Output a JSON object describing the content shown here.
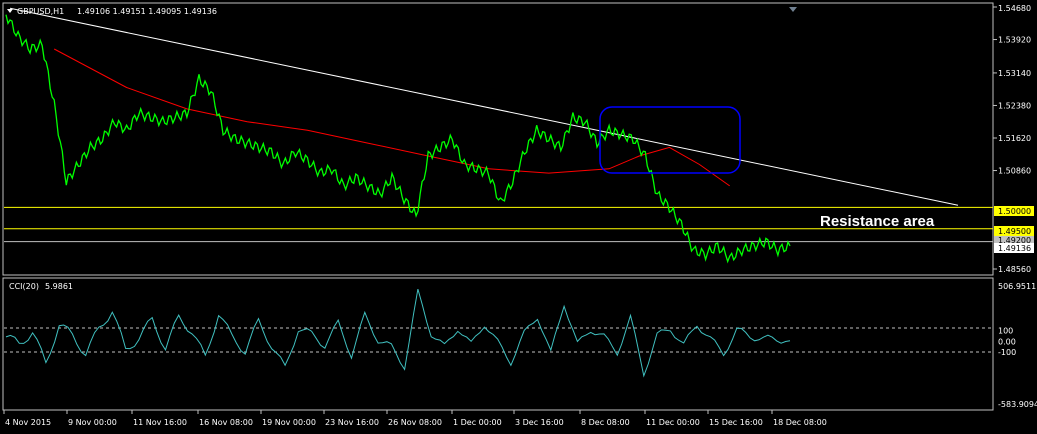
{
  "header": {
    "symbol": "GBPUSD,H1",
    "ohlc": "1.49106 1.49151 1.49095 1.49136"
  },
  "indicator_header": {
    "name": "CCI(20)",
    "value": "5.9861"
  },
  "annotation": "Resistance area",
  "price_axis": {
    "ticks": [
      "1.54680",
      "1.53920",
      "1.53140",
      "1.52380",
      "1.51620",
      "1.50860",
      "1.48560"
    ],
    "levels": [
      {
        "label": "1.50000",
        "value": 1.5
      },
      {
        "label": "1.49500",
        "value": 1.495
      },
      {
        "label": "1.49200",
        "value": 1.492
      }
    ],
    "current": {
      "label": "1.49136",
      "value": 1.49136
    }
  },
  "cci_axis": {
    "ticks": [
      "506.9511",
      "100",
      "0.00",
      "-100",
      "-583.9094"
    ]
  },
  "time_axis": [
    "4 Nov 2015",
    "9 Nov 00:00",
    "11 Nov 16:00",
    "16 Nov 08:00",
    "19 Nov 00:00",
    "23 Nov 16:00",
    "26 Nov 08:00",
    "1 Dec 00:00",
    "3 Dec 16:00",
    "8 Dec 08:00",
    "11 Dec 00:00",
    "15 Dec 16:00",
    "18 Dec 08:00"
  ],
  "colors": {
    "background": "#000000",
    "price": "#00ff00",
    "ma": "#ff0000",
    "trendline": "#ffffff",
    "level": "#ffff00",
    "highlight": "#0000ff",
    "cci": "#40c0c0"
  },
  "chart_data": {
    "type": "line",
    "title": "GBPUSD,H1",
    "ylim": [
      1.4856,
      1.5468
    ],
    "price_series": {
      "name": "GBPUSD",
      "x_index": [
        0,
        2,
        4,
        6,
        8,
        10,
        12,
        14,
        16,
        18,
        20,
        22,
        24,
        26,
        28,
        30,
        32,
        34,
        36,
        38,
        40,
        42,
        44,
        46,
        48,
        50,
        52,
        54,
        56,
        58,
        60,
        62,
        64,
        66,
        68,
        70,
        72,
        74,
        76,
        78,
        80,
        82,
        84,
        86,
        88,
        90,
        92,
        94,
        96,
        98,
        100,
        102,
        104,
        106,
        108,
        110,
        112,
        114,
        116,
        118,
        120,
        122,
        124,
        126,
        128,
        130
      ],
      "values": [
        1.545,
        1.54,
        1.537,
        1.538,
        1.524,
        1.506,
        1.51,
        1.514,
        1.516,
        1.52,
        1.518,
        1.522,
        1.521,
        1.52,
        1.521,
        1.522,
        1.53,
        1.527,
        1.518,
        1.516,
        1.515,
        1.514,
        1.513,
        1.51,
        1.513,
        1.511,
        1.508,
        1.509,
        1.505,
        1.507,
        1.505,
        1.503,
        1.507,
        1.502,
        1.498,
        1.512,
        1.514,
        1.516,
        1.51,
        1.509,
        1.508,
        1.501,
        1.506,
        1.513,
        1.518,
        1.516,
        1.514,
        1.521,
        1.52,
        1.515,
        1.518,
        1.517,
        1.516,
        1.512,
        1.503,
        1.5,
        1.496,
        1.49,
        1.489,
        1.491,
        1.488,
        1.49,
        1.491,
        1.492,
        1.49,
        1.491
      ]
    },
    "ma_series": {
      "name": "MA",
      "x_index": [
        8,
        20,
        30,
        40,
        50,
        60,
        70,
        80,
        90,
        100,
        105,
        110,
        115,
        120
      ],
      "values": [
        1.537,
        1.528,
        1.523,
        1.52,
        1.518,
        1.515,
        1.512,
        1.509,
        1.508,
        1.509,
        1.512,
        1.514,
        1.51,
        1.505
      ]
    },
    "trendline": {
      "from_value": 1.5465,
      "to_value": 1.5005
    },
    "cci_series": {
      "name": "CCI(20)",
      "values": [
        40,
        -20,
        80,
        -200,
        150,
        60,
        -120,
        120,
        280,
        -80,
        30,
        200,
        -60,
        220,
        90,
        -150,
        260,
        40,
        -90,
        180,
        -40,
        -250,
        120,
        60,
        -30,
        160,
        -120,
        230,
        20,
        -60,
        -220,
        440,
        80,
        -60,
        130,
        -40,
        170,
        -20,
        -180,
        60,
        240,
        -120,
        360,
        -40,
        120,
        30,
        -90,
        200,
        -280,
        40,
        130,
        -50,
        170,
        10,
        -100,
        90,
        60,
        10,
        30,
        5.98
      ]
    }
  }
}
